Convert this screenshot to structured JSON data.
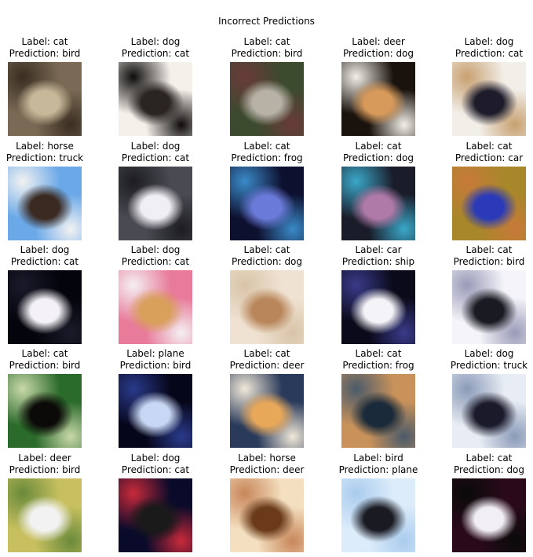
{
  "figure": {
    "title": "Incorrect Predictions"
  },
  "samples": [
    {
      "label": "Label: cat",
      "prediction": "Prediction: bird",
      "thumb": {
        "bg": "#7a6a55",
        "accent": "#c8b89a",
        "shade": "#3a2e22"
      }
    },
    {
      "label": "Label: dog",
      "prediction": "Prediction: cat",
      "thumb": {
        "bg": "#f4f0ea",
        "accent": "#2a2422",
        "shade": "#0e0c0b"
      }
    },
    {
      "label": "Label: cat",
      "prediction": "Prediction: bird",
      "thumb": {
        "bg": "#3c4a2e",
        "accent": "#b8b2a6",
        "shade": "#6a3a3a"
      }
    },
    {
      "label": "Label: deer",
      "prediction": "Prediction: dog",
      "thumb": {
        "bg": "#1a120c",
        "accent": "#d89a5a",
        "shade": "#f2efe9"
      }
    },
    {
      "label": "Label: dog",
      "prediction": "Prediction: cat",
      "thumb": {
        "bg": "#f2eee8",
        "accent": "#1e1c2a",
        "shade": "#c8a070"
      }
    },
    {
      "label": "Label: horse",
      "prediction": "Prediction: truck",
      "thumb": {
        "bg": "#6aa8e8",
        "accent": "#3a2a22",
        "shade": "#f2f2f2"
      }
    },
    {
      "label": "Label: dog",
      "prediction": "Prediction: cat",
      "thumb": {
        "bg": "#4a4a52",
        "accent": "#f0f0f4",
        "shade": "#1c1c22"
      }
    },
    {
      "label": "Label: cat",
      "prediction": "Prediction: frog",
      "thumb": {
        "bg": "#0e1030",
        "accent": "#6a7ad8",
        "shade": "#3a8ac8"
      }
    },
    {
      "label": "Label: cat",
      "prediction": "Prediction: dog",
      "thumb": {
        "bg": "#1a1c2a",
        "accent": "#b07aa8",
        "shade": "#3aa8c8"
      }
    },
    {
      "label": "Label: cat",
      "prediction": "Prediction: car",
      "thumb": {
        "bg": "#a8862a",
        "accent": "#2a3ab8",
        "shade": "#c87a3a"
      }
    },
    {
      "label": "Label: dog",
      "prediction": "Prediction: cat",
      "thumb": {
        "bg": "#04040c",
        "accent": "#f4f2f6",
        "shade": "#1a1a2a"
      }
    },
    {
      "label": "Label: dog",
      "prediction": "Prediction: cat",
      "thumb": {
        "bg": "#e87a9a",
        "accent": "#d8a05a",
        "shade": "#f4f0f2"
      }
    },
    {
      "label": "Label: cat",
      "prediction": "Prediction: dog",
      "thumb": {
        "bg": "#f0e2d2",
        "accent": "#b8865a",
        "shade": "#d8c4a8"
      }
    },
    {
      "label": "Label: car",
      "prediction": "Prediction: ship",
      "thumb": {
        "bg": "#0a0a1a",
        "accent": "#f4f4f8",
        "shade": "#3a3a8a"
      }
    },
    {
      "label": "Label: cat",
      "prediction": "Prediction: bird",
      "thumb": {
        "bg": "#f4f4fa",
        "accent": "#1a1a22",
        "shade": "#9a9ab8"
      }
    },
    {
      "label": "Label: cat",
      "prediction": "Prediction: bird",
      "thumb": {
        "bg": "#2a6a2a",
        "accent": "#0c0a08",
        "shade": "#c8d8a8"
      }
    },
    {
      "label": "Label: plane",
      "prediction": "Prediction: bird",
      "thumb": {
        "bg": "#06061a",
        "accent": "#c8d8f4",
        "shade": "#2a3a8a"
      }
    },
    {
      "label": "Label: cat",
      "prediction": "Prediction: deer",
      "thumb": {
        "bg": "#2a3a5a",
        "accent": "#e8a85a",
        "shade": "#f0e8d8"
      }
    },
    {
      "label": "Label: cat",
      "prediction": "Prediction: frog",
      "thumb": {
        "bg": "#c8925a",
        "accent": "#1a2a3a",
        "shade": "#4a5a6a"
      }
    },
    {
      "label": "Label: dog",
      "prediction": "Prediction: truck",
      "thumb": {
        "bg": "#e8ecf4",
        "accent": "#1a1a2a",
        "shade": "#8a9ab8"
      }
    },
    {
      "label": "Label: deer",
      "prediction": "Prediction: bird",
      "thumb": {
        "bg": "#c8c060",
        "accent": "#f2f2f2",
        "shade": "#6a8a3a"
      }
    },
    {
      "label": "Label: dog",
      "prediction": "Prediction: cat",
      "thumb": {
        "bg": "#0a0a2a",
        "accent": "#1a1a1a",
        "shade": "#c82a3a"
      }
    },
    {
      "label": "Label: horse",
      "prediction": "Prediction: deer",
      "thumb": {
        "bg": "#f4e0c0",
        "accent": "#6a3a1a",
        "shade": "#c8865a"
      }
    },
    {
      "label": "Label: bird",
      "prediction": "Prediction: plane",
      "thumb": {
        "bg": "#dcecfa",
        "accent": "#1a1a22",
        "shade": "#aaccee"
      }
    },
    {
      "label": "Label: cat",
      "prediction": "Prediction: dog",
      "thumb": {
        "bg": "#2a0a1a",
        "accent": "#f2eef6",
        "shade": "#0a0a0a"
      }
    }
  ]
}
